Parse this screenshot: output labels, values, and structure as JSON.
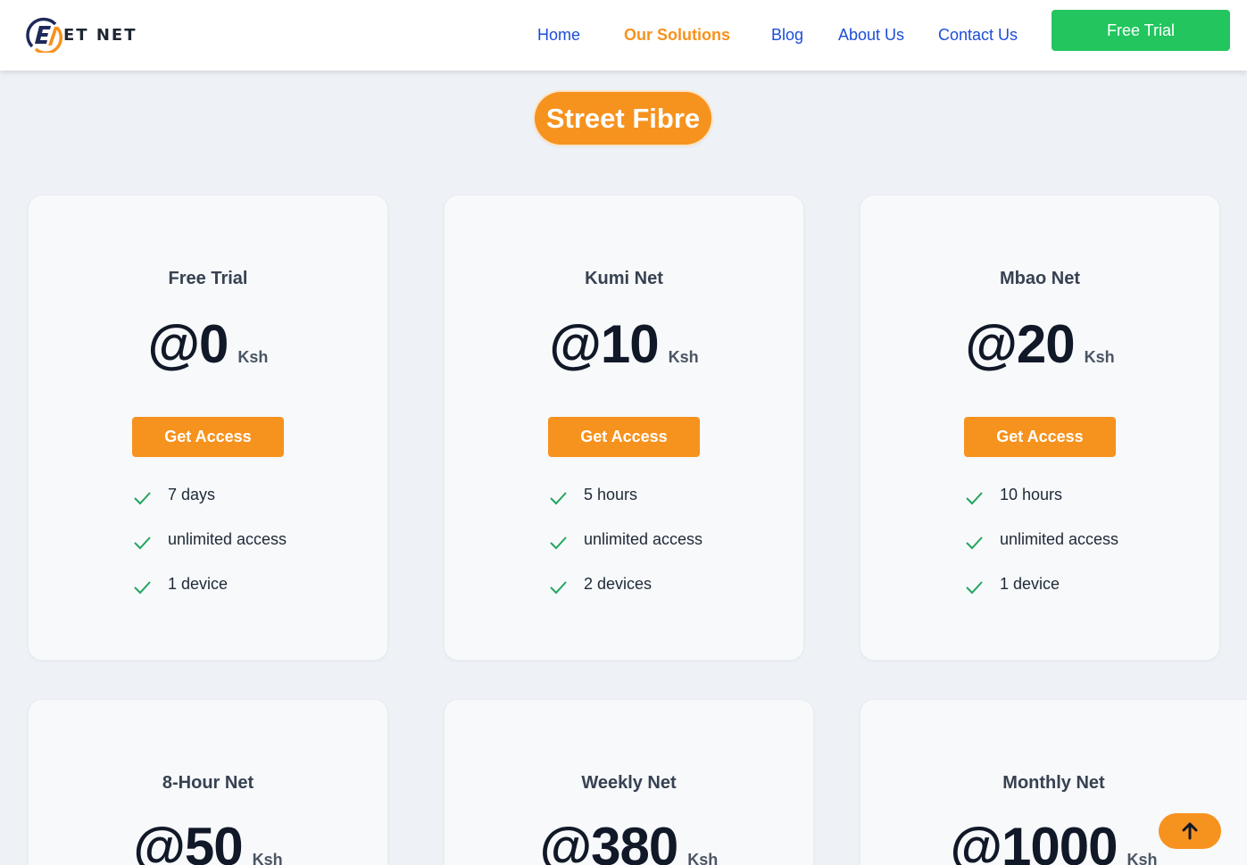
{
  "brand": {
    "name": "ET NET",
    "colors": {
      "accent": "#f6921e",
      "primary_link": "#1d4ed8",
      "cta_green": "#22c55e",
      "check_green": "#22a55e"
    }
  },
  "nav": {
    "links": [
      "Home",
      "Our Solutions",
      "Blog",
      "About Us",
      "Contact Us"
    ],
    "active": "Our Solutions",
    "cta_label": "Free Trial"
  },
  "section": {
    "title": "Street Fibre"
  },
  "plans": [
    {
      "name": "Free Trial",
      "price": "@0",
      "currency": "Ksh",
      "button": "Get Access",
      "features": [
        "7 days",
        "unlimited access",
        "1 device"
      ]
    },
    {
      "name": "Kumi Net",
      "price": "@10",
      "currency": "Ksh",
      "button": "Get Access",
      "features": [
        "5 hours",
        "unlimited access",
        "2 devices"
      ]
    },
    {
      "name": "Mbao Net",
      "price": "@20",
      "currency": "Ksh",
      "button": "Get Access",
      "features": [
        "10 hours",
        "unlimited access",
        "1 device"
      ]
    },
    {
      "name": "8-Hour Net",
      "price": "@50",
      "currency": "Ksh"
    },
    {
      "name": "Weekly Net",
      "price": "@380",
      "currency": "Ksh"
    },
    {
      "name": "Monthly Net",
      "price": "@1000",
      "currency": "Ksh"
    }
  ],
  "icons": {
    "check": "check-icon",
    "scroll_top": "arrow-up-icon",
    "logo": "logo-icon"
  }
}
